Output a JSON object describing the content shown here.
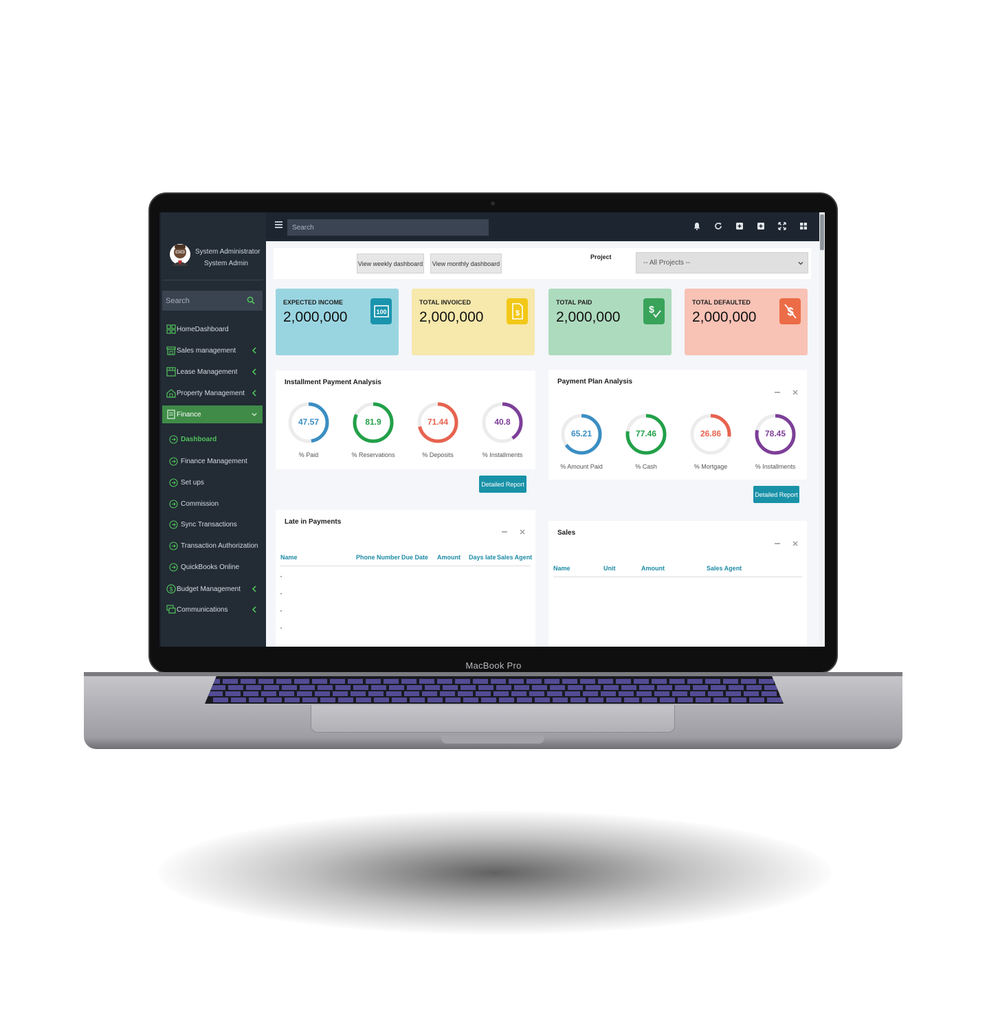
{
  "device": {
    "brand": "MacBook Pro"
  },
  "sidebar": {
    "user_name": "System Administrator",
    "user_role": "System Admin",
    "search_placeholder": "Search",
    "items": [
      {
        "label": "HomeDashboard",
        "icon": "dashboard-grid-icon"
      },
      {
        "label": "Sales management",
        "icon": "store-icon"
      },
      {
        "label": "Lease Management",
        "icon": "shop-icon"
      },
      {
        "label": "Property Management",
        "icon": "property-icon"
      },
      {
        "label": "Finance",
        "icon": "finance-doc-icon"
      }
    ],
    "finance_sub": [
      {
        "label": "Dashboard"
      },
      {
        "label": "Finance Management"
      },
      {
        "label": "Set ups"
      },
      {
        "label": "Commission"
      },
      {
        "label": "Sync Transactions"
      },
      {
        "label": "Transaction Authorization"
      },
      {
        "label": "QuickBooks Online"
      }
    ],
    "items_after": [
      {
        "label": "Budget Management",
        "icon": "dollar-circle-icon"
      },
      {
        "label": "Communications",
        "icon": "chat-icon"
      }
    ]
  },
  "topbar": {
    "search_placeholder": "Search"
  },
  "toolbar": {
    "weekly_label": "View weekly dashboard",
    "monthly_label": "View monthly dashboard",
    "project_label": "Project",
    "project_selected": "-- All Projects --"
  },
  "stats": [
    {
      "title": "EXPECTED INCOME",
      "value": "2,000,000",
      "bg": "#99d5e1",
      "icon_bg": "#1a94ad"
    },
    {
      "title": "TOTAL INVOICED",
      "value": "2,000,000",
      "bg": "#f7e8ab",
      "icon_bg": "#f2c818"
    },
    {
      "title": "TOTAL PAID",
      "value": "2,000,000",
      "bg": "#addbbd",
      "icon_bg": "#39a35a"
    },
    {
      "title": "TOTAL DEFAULTED",
      "value": "2,000,000",
      "bg": "#f8c2b5",
      "icon_bg": "#ec6c47"
    }
  ],
  "installment_analysis": {
    "title": "Installment Payment Analysis",
    "button": "Detailed Report",
    "donuts": [
      {
        "value": "47.57",
        "pct": 47.57,
        "label": "% Paid",
        "color": "#3a8ec3"
      },
      {
        "value": "81.9",
        "pct": 81.9,
        "label": "% Reservations",
        "color": "#22a049"
      },
      {
        "value": "71.44",
        "pct": 71.44,
        "label": "% Deposits",
        "color": "#e7634f"
      },
      {
        "value": "40.8",
        "pct": 40.8,
        "label": "% Installments",
        "color": "#7d3f98"
      }
    ]
  },
  "payment_plan": {
    "title": "Payment Plan Analysis",
    "button": "Detailed Report",
    "donuts": [
      {
        "value": "65.21",
        "pct": 65.21,
        "label": "% Amount Paid",
        "color": "#3a8ec3"
      },
      {
        "value": "77.46",
        "pct": 77.46,
        "label": "% Cash",
        "color": "#22a049"
      },
      {
        "value": "26.86",
        "pct": 26.86,
        "label": "% Mortgage",
        "color": "#e7634f"
      },
      {
        "value": "78.45",
        "pct": 78.45,
        "label": "% Installments",
        "color": "#7d3f98"
      }
    ]
  },
  "late_payments": {
    "title": "Late in Payments",
    "columns": [
      "Name",
      "Phone Number",
      "Due Date",
      "Amount",
      "Days late",
      "Sales Agent"
    ]
  },
  "sales": {
    "title": "Sales",
    "columns": [
      "Name",
      "Unit",
      "Amount",
      "Sales Agent"
    ]
  }
}
